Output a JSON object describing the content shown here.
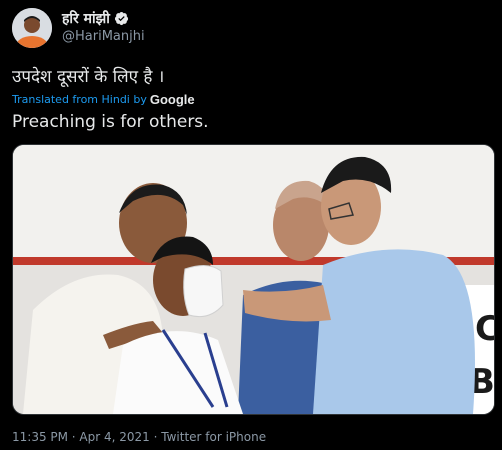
{
  "tweet": {
    "display_name": "हरि मांझी",
    "handle": "@HariManjhi",
    "original_text": "उपदेश दूसरों के लिए है ।",
    "translated_from": "Translated from Hindi by",
    "translator_brand": "Google",
    "translated_text": "Preaching is for others.",
    "timestamp": "11:35 PM · Apr 4, 2021 · Twitter for iPhone"
  },
  "media": {
    "banner_letter_top": "C",
    "banner_letter_bottom": "B"
  },
  "icons": {
    "verified": "verified-badge-icon"
  },
  "colors": {
    "background": "#000000",
    "text": "#e7e9ea",
    "secondary": "#8b98a5",
    "link": "#1d9bf0"
  }
}
